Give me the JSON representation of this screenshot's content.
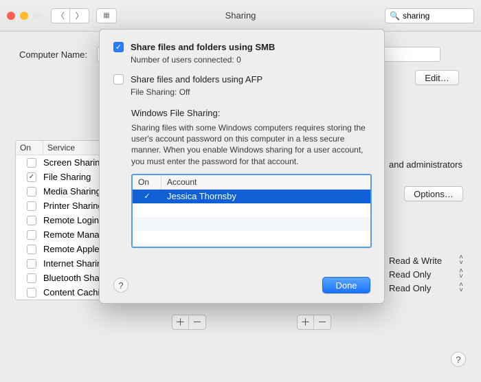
{
  "window": {
    "title": "Sharing"
  },
  "search": {
    "value": "sharing"
  },
  "computerName": {
    "label": "Computer Name:",
    "editLabel": "Edit…"
  },
  "services": {
    "colOn": "On",
    "colService": "Service",
    "items": [
      {
        "label": "Screen Sharing",
        "checked": false
      },
      {
        "label": "File Sharing",
        "checked": true
      },
      {
        "label": "Media Sharing",
        "checked": false
      },
      {
        "label": "Printer Sharing",
        "checked": false
      },
      {
        "label": "Remote Login",
        "checked": false
      },
      {
        "label": "Remote Management",
        "checked": false
      },
      {
        "label": "Remote Apple Events",
        "checked": false
      },
      {
        "label": "Internet Sharing",
        "checked": false
      },
      {
        "label": "Bluetooth Sharing",
        "checked": false
      },
      {
        "label": "Content Caching",
        "checked": false
      }
    ]
  },
  "rightText": "and administrators",
  "optionsLabel": "Options…",
  "permissions": [
    {
      "label": "Read & Write"
    },
    {
      "label": "Read Only"
    },
    {
      "label": "Read Only"
    }
  ],
  "sheet": {
    "smb": {
      "title": "Share files and folders using SMB",
      "sub": "Number of users connected: 0"
    },
    "afp": {
      "title": "Share files and folders using AFP",
      "sub": "File Sharing: Off"
    },
    "wfsTitle": "Windows File Sharing:",
    "wfsDesc": "Sharing files with some Windows computers requires storing the user's account password on this computer in a less secure manner. When you enable Windows sharing for a user account, you must enter the password for that account.",
    "acctHdr": {
      "on": "On",
      "account": "Account"
    },
    "accounts": [
      {
        "name": "Jessica Thornsby",
        "checked": true,
        "selected": true
      }
    ],
    "done": "Done"
  }
}
